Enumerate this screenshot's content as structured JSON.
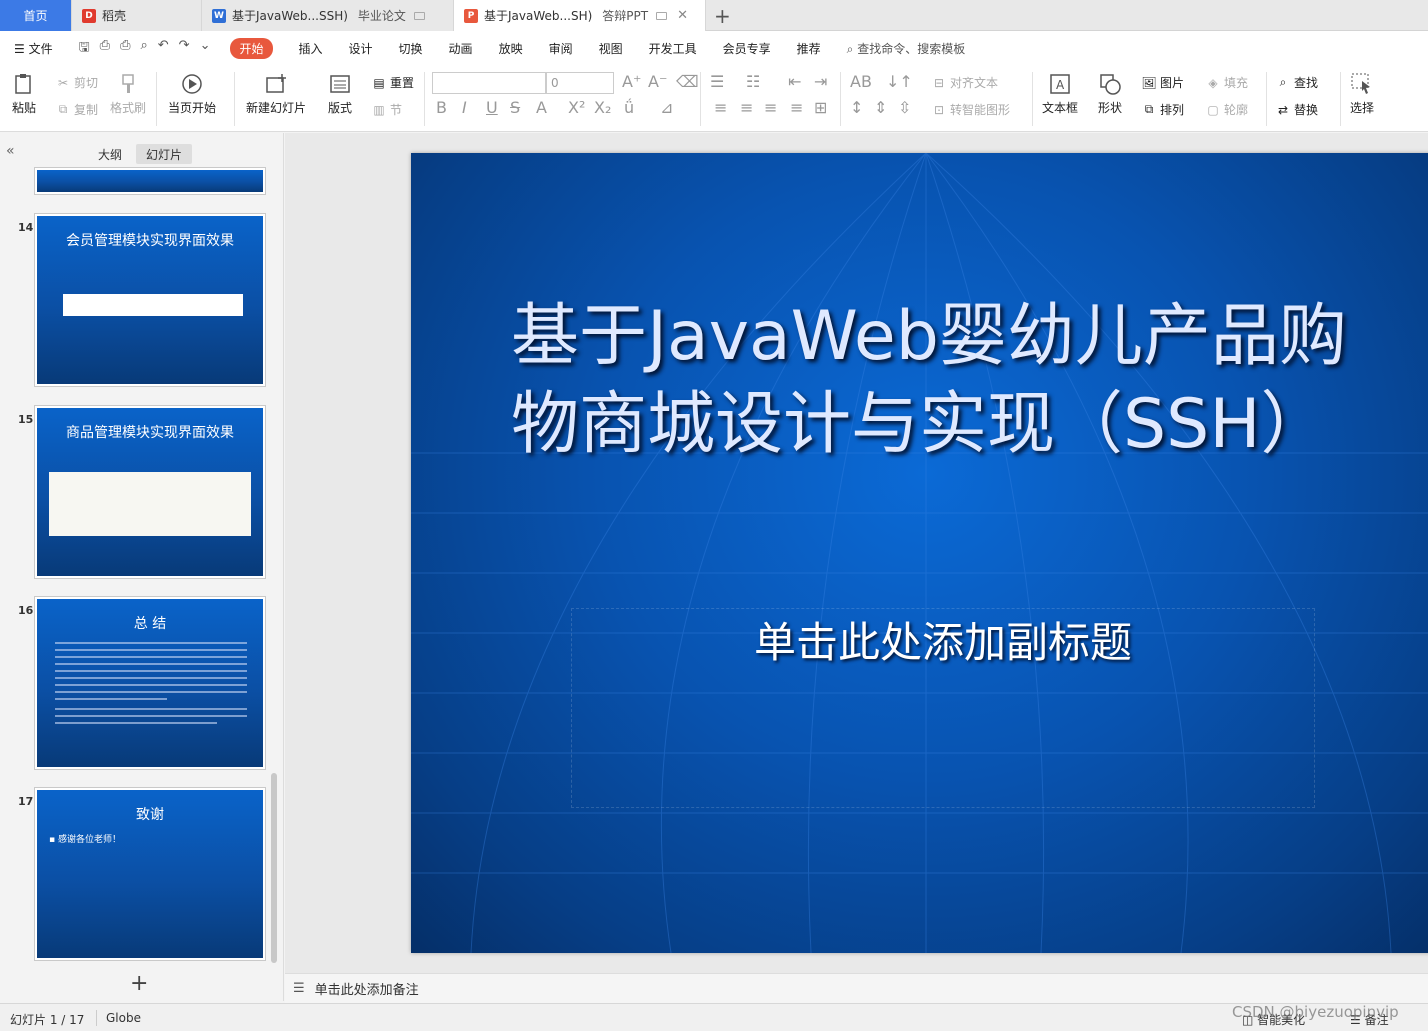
{
  "tabs": {
    "home": "首页",
    "daoke": "稻壳",
    "doc_title": "基于JavaWeb...SSH)",
    "doc_sub": "毕业论文",
    "ppt_title": "基于JavaWeb...SH)",
    "ppt_sub": "答辩PPT"
  },
  "menu": {
    "file": "文件",
    "items": [
      "开始",
      "插入",
      "设计",
      "切换",
      "动画",
      "放映",
      "审阅",
      "视图",
      "开发工具",
      "会员专享",
      "推荐"
    ],
    "search": "查找命令、搜索模板"
  },
  "ribbon": {
    "paste": "粘贴",
    "cut": "剪切",
    "copy": "复制",
    "format_painter": "格式刷",
    "from_current": "当页开始",
    "new_slide": "新建幻灯片",
    "layout": "版式",
    "reset": "重置",
    "section": "节",
    "font_size_value": "0",
    "align_text": "对齐文本",
    "to_smartart": "转智能图形",
    "textbox": "文本框",
    "shapes": "形状",
    "picture": "图片",
    "arrange": "排列",
    "fill": "填充",
    "outline": "轮廓",
    "find": "查找",
    "replace": "替换",
    "select": "选择"
  },
  "panel": {
    "outline_tab": "大纲",
    "slides_tab": "幻灯片",
    "slides": [
      {
        "num": "14",
        "title": "会员管理模块实现界面效果"
      },
      {
        "num": "15",
        "title": "商品管理模块实现界面效果"
      },
      {
        "num": "16",
        "title": "总 结"
      },
      {
        "num": "17",
        "title": "致谢",
        "bullet": "感谢各位老师！"
      }
    ]
  },
  "slide": {
    "title": "基于JavaWeb婴幼儿产品购物商城设计与实现（SSH）",
    "subtitle_placeholder": "单击此处添加副标题"
  },
  "notes_placeholder": "单击此处添加备注",
  "status": {
    "slide_pos": "幻灯片 1 / 17",
    "theme": "Globe",
    "smart_beautify": "智能美化",
    "notes": "备注"
  },
  "watermark": "CSDN @biyezuopinvip",
  "colors": {
    "accent": "#e8583d",
    "home_tab": "#3c7ae6",
    "slide_bg": "#0853b0"
  }
}
